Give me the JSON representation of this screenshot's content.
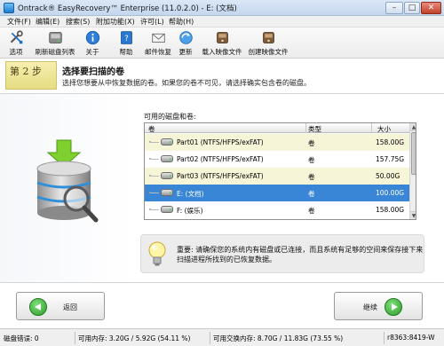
{
  "window": {
    "title": "Ontrack® EasyRecovery™ Enterprise (11.0.2.0) - E: (文档)",
    "minimize": "–",
    "maximize": "□",
    "close": "✕"
  },
  "menu": [
    "文件(F)",
    "编辑(E)",
    "搜索(S)",
    "附加功能(X)",
    "许可(L)",
    "帮助(H)"
  ],
  "toolbar": [
    {
      "label": "选项",
      "icon": "wrench-screwdriver-icon"
    },
    {
      "label": "刷新磁盘列表",
      "icon": "refresh-disk-icon"
    },
    {
      "label": "关于",
      "icon": "info-icon"
    },
    {
      "label": "帮助",
      "icon": "help-book-icon"
    },
    {
      "label": "邮件恢复",
      "icon": "mail-icon"
    },
    {
      "label": "更新",
      "icon": "update-globe-icon"
    },
    {
      "label": "载入映像文件",
      "icon": "load-image-icon"
    },
    {
      "label": "创建映像文件",
      "icon": "create-image-icon"
    }
  ],
  "step": {
    "number": "第 2 步",
    "title": "选择要扫描的卷",
    "description": "选择您想要从中恢复数据的卷。如果您的卷不可见，请选择确实包含卷的磁盘。"
  },
  "volumes": {
    "label": "可用的磁盘和卷:",
    "columns": [
      "卷",
      "类型",
      "大小"
    ],
    "rows": [
      {
        "name": "Part01 (NTFS/HFPS/exFAT)",
        "type": "卷",
        "size": "158.00G"
      },
      {
        "name": "Part02 (NTFS/HFPS/exFAT)",
        "type": "卷",
        "size": "157.75G"
      },
      {
        "name": "Part03 (NTFS/HFPS/exFAT)",
        "type": "卷",
        "size": "50.00G"
      },
      {
        "name": "E: (文档)",
        "type": "卷",
        "size": "100.00G"
      },
      {
        "name": "F: (娱乐)",
        "type": "卷",
        "size": "158.00G"
      }
    ],
    "selected_index": 3,
    "scroll_up": "▲",
    "scroll_down": "▼"
  },
  "notice": {
    "text": "重要: 请确保您的系统内有磁盘或已连接，而且系统有足够的空间来保存接下来扫描进程所找到的已恢复数据。"
  },
  "nav": {
    "back": "返回",
    "next": "继续"
  },
  "status": {
    "disk_errors": "磁盘错误: 0",
    "mem_available": "可用内存: 3.20G / 5.92G (54.11 %)",
    "swap_available": "可用交换内存: 8.70G / 11.83G (73.55 %)",
    "build": "r8363:8419-W"
  },
  "colors": {
    "selection": "#3a86d6",
    "alt_row": "#f7f5d8",
    "step_tag": "#e6dc82"
  }
}
